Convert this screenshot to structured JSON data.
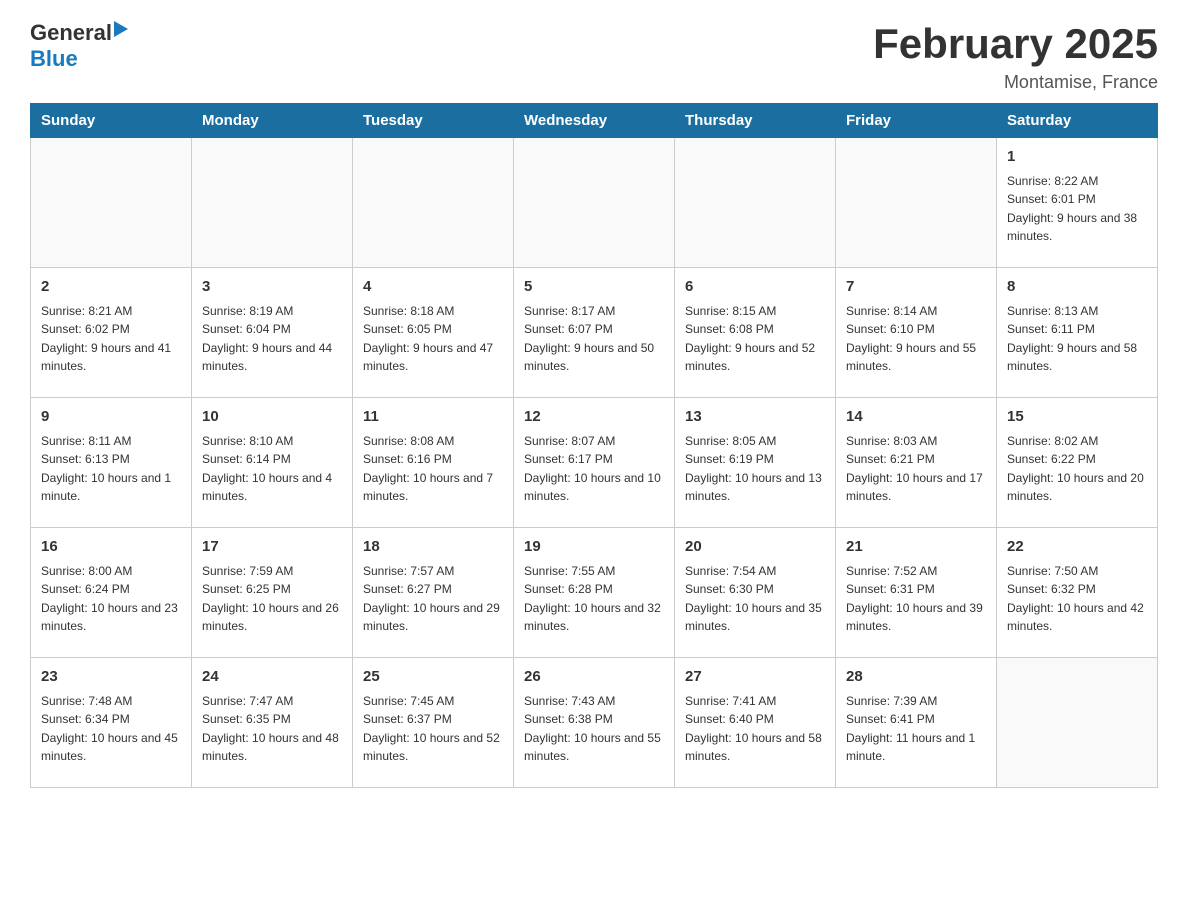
{
  "header": {
    "logo_general": "General",
    "logo_arrow": "▶",
    "logo_blue": "Blue",
    "title": "February 2025",
    "subtitle": "Montamise, France"
  },
  "weekdays": [
    "Sunday",
    "Monday",
    "Tuesday",
    "Wednesday",
    "Thursday",
    "Friday",
    "Saturday"
  ],
  "weeks": [
    [
      {
        "day": "",
        "info": ""
      },
      {
        "day": "",
        "info": ""
      },
      {
        "day": "",
        "info": ""
      },
      {
        "day": "",
        "info": ""
      },
      {
        "day": "",
        "info": ""
      },
      {
        "day": "",
        "info": ""
      },
      {
        "day": "1",
        "info": "Sunrise: 8:22 AM\nSunset: 6:01 PM\nDaylight: 9 hours and 38 minutes."
      }
    ],
    [
      {
        "day": "2",
        "info": "Sunrise: 8:21 AM\nSunset: 6:02 PM\nDaylight: 9 hours and 41 minutes."
      },
      {
        "day": "3",
        "info": "Sunrise: 8:19 AM\nSunset: 6:04 PM\nDaylight: 9 hours and 44 minutes."
      },
      {
        "day": "4",
        "info": "Sunrise: 8:18 AM\nSunset: 6:05 PM\nDaylight: 9 hours and 47 minutes."
      },
      {
        "day": "5",
        "info": "Sunrise: 8:17 AM\nSunset: 6:07 PM\nDaylight: 9 hours and 50 minutes."
      },
      {
        "day": "6",
        "info": "Sunrise: 8:15 AM\nSunset: 6:08 PM\nDaylight: 9 hours and 52 minutes."
      },
      {
        "day": "7",
        "info": "Sunrise: 8:14 AM\nSunset: 6:10 PM\nDaylight: 9 hours and 55 minutes."
      },
      {
        "day": "8",
        "info": "Sunrise: 8:13 AM\nSunset: 6:11 PM\nDaylight: 9 hours and 58 minutes."
      }
    ],
    [
      {
        "day": "9",
        "info": "Sunrise: 8:11 AM\nSunset: 6:13 PM\nDaylight: 10 hours and 1 minute."
      },
      {
        "day": "10",
        "info": "Sunrise: 8:10 AM\nSunset: 6:14 PM\nDaylight: 10 hours and 4 minutes."
      },
      {
        "day": "11",
        "info": "Sunrise: 8:08 AM\nSunset: 6:16 PM\nDaylight: 10 hours and 7 minutes."
      },
      {
        "day": "12",
        "info": "Sunrise: 8:07 AM\nSunset: 6:17 PM\nDaylight: 10 hours and 10 minutes."
      },
      {
        "day": "13",
        "info": "Sunrise: 8:05 AM\nSunset: 6:19 PM\nDaylight: 10 hours and 13 minutes."
      },
      {
        "day": "14",
        "info": "Sunrise: 8:03 AM\nSunset: 6:21 PM\nDaylight: 10 hours and 17 minutes."
      },
      {
        "day": "15",
        "info": "Sunrise: 8:02 AM\nSunset: 6:22 PM\nDaylight: 10 hours and 20 minutes."
      }
    ],
    [
      {
        "day": "16",
        "info": "Sunrise: 8:00 AM\nSunset: 6:24 PM\nDaylight: 10 hours and 23 minutes."
      },
      {
        "day": "17",
        "info": "Sunrise: 7:59 AM\nSunset: 6:25 PM\nDaylight: 10 hours and 26 minutes."
      },
      {
        "day": "18",
        "info": "Sunrise: 7:57 AM\nSunset: 6:27 PM\nDaylight: 10 hours and 29 minutes."
      },
      {
        "day": "19",
        "info": "Sunrise: 7:55 AM\nSunset: 6:28 PM\nDaylight: 10 hours and 32 minutes."
      },
      {
        "day": "20",
        "info": "Sunrise: 7:54 AM\nSunset: 6:30 PM\nDaylight: 10 hours and 35 minutes."
      },
      {
        "day": "21",
        "info": "Sunrise: 7:52 AM\nSunset: 6:31 PM\nDaylight: 10 hours and 39 minutes."
      },
      {
        "day": "22",
        "info": "Sunrise: 7:50 AM\nSunset: 6:32 PM\nDaylight: 10 hours and 42 minutes."
      }
    ],
    [
      {
        "day": "23",
        "info": "Sunrise: 7:48 AM\nSunset: 6:34 PM\nDaylight: 10 hours and 45 minutes."
      },
      {
        "day": "24",
        "info": "Sunrise: 7:47 AM\nSunset: 6:35 PM\nDaylight: 10 hours and 48 minutes."
      },
      {
        "day": "25",
        "info": "Sunrise: 7:45 AM\nSunset: 6:37 PM\nDaylight: 10 hours and 52 minutes."
      },
      {
        "day": "26",
        "info": "Sunrise: 7:43 AM\nSunset: 6:38 PM\nDaylight: 10 hours and 55 minutes."
      },
      {
        "day": "27",
        "info": "Sunrise: 7:41 AM\nSunset: 6:40 PM\nDaylight: 10 hours and 58 minutes."
      },
      {
        "day": "28",
        "info": "Sunrise: 7:39 AM\nSunset: 6:41 PM\nDaylight: 11 hours and 1 minute."
      },
      {
        "day": "",
        "info": ""
      }
    ]
  ]
}
